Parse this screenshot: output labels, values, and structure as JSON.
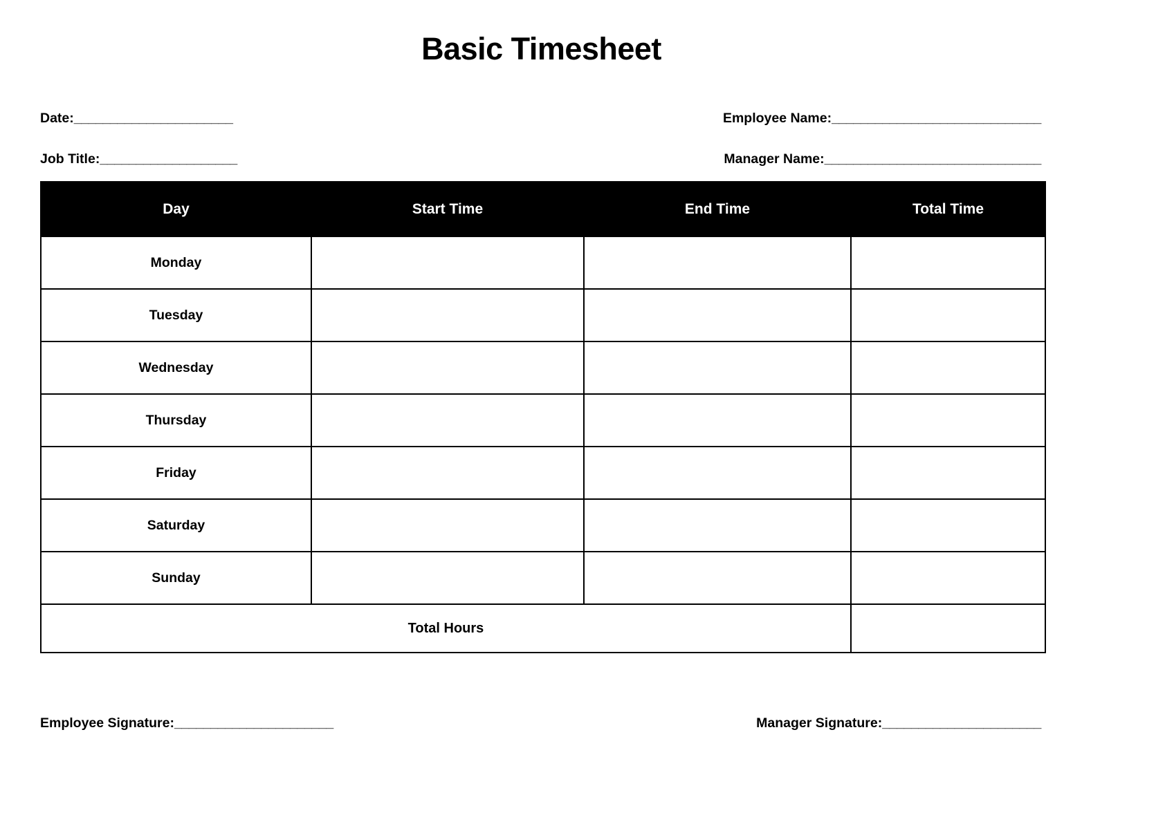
{
  "document": {
    "title": "Basic Timesheet",
    "accent_color": "#000000",
    "background_color": "#ffffff",
    "text_color": "#000000"
  },
  "header_fields": {
    "date": {
      "label": "Date: ",
      "line": "______________________",
      "value": ""
    },
    "job_title": {
      "label": "Job Title:",
      "line": "___________________",
      "value": ""
    },
    "employee_name": {
      "label": "Employee Name: ",
      "line": "_____________________________",
      "value": ""
    },
    "manager_name": {
      "label": "Manager Name: ",
      "line": "______________________________",
      "value": ""
    }
  },
  "table": {
    "columns": [
      {
        "key": "day",
        "label": "Day"
      },
      {
        "key": "start_time",
        "label": "Start Time"
      },
      {
        "key": "end_time",
        "label": "End Time"
      },
      {
        "key": "total_time",
        "label": "Total Time"
      }
    ],
    "rows": [
      {
        "day": "Monday",
        "start_time": "",
        "end_time": "",
        "total_time": ""
      },
      {
        "day": "Tuesday",
        "start_time": "",
        "end_time": "",
        "total_time": ""
      },
      {
        "day": "Wednesday",
        "start_time": "",
        "end_time": "",
        "total_time": ""
      },
      {
        "day": "Thursday",
        "start_time": "",
        "end_time": "",
        "total_time": ""
      },
      {
        "day": "Friday",
        "start_time": "",
        "end_time": "",
        "total_time": ""
      },
      {
        "day": "Saturday",
        "start_time": "",
        "end_time": "",
        "total_time": ""
      },
      {
        "day": "Sunday",
        "start_time": "",
        "end_time": "",
        "total_time": ""
      }
    ],
    "total_row": {
      "label": "Total Hours",
      "value": ""
    }
  },
  "signatures": {
    "employee": {
      "label": "Employee Signature:",
      "line": "______________________",
      "value": ""
    },
    "manager": {
      "label": "Manager Signature:",
      "line": "______________________",
      "value": ""
    }
  }
}
